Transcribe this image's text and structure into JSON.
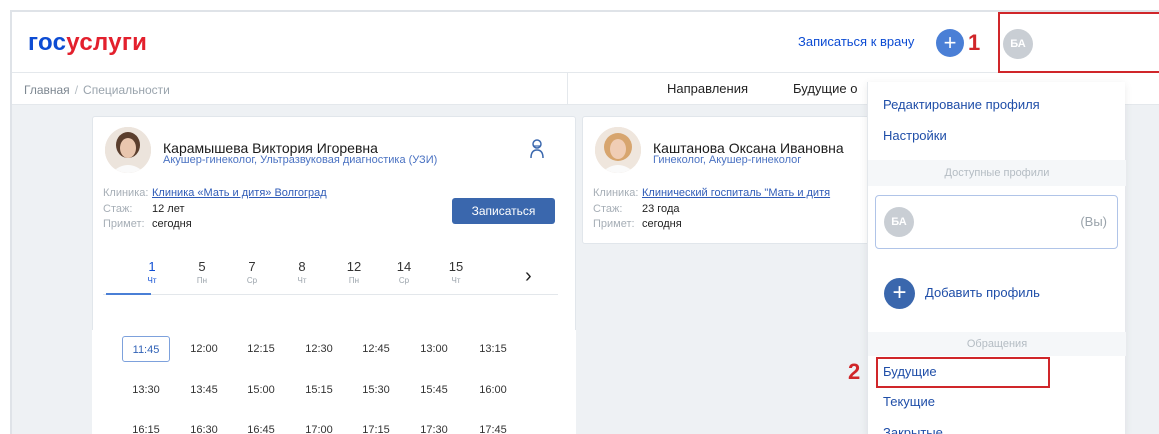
{
  "header": {
    "logo_part1": "гос",
    "logo_part2": "услуги",
    "book_link": "Записаться к врачу",
    "plus_symbol": "+",
    "avatar_initials": "БА",
    "annotation_1": "1"
  },
  "breadcrumb": {
    "home": "Главная",
    "separator": "/",
    "current": "Специальности"
  },
  "tabs": [
    "Направления",
    "Будущие о"
  ],
  "doctors": [
    {
      "name": "Карамышева Виктория Игоревна",
      "specialty": "Акушер-гинеколог, Ультразвуковая диагностика (УЗИ)",
      "clinic_label": "Клиника:",
      "clinic": "Клиника «Мать и дитя» Волгоград",
      "experience_label": "Стаж:",
      "experience": "12 лет",
      "accepts_label": "Примет:",
      "accepts": "сегодня",
      "book_button": "Записаться"
    },
    {
      "name": "Каштанова Оксана Ивановна",
      "specialty": "Гинеколог, Акушер-гинеколог",
      "clinic_label": "Клиника:",
      "clinic": "Клинический госпиталь \"Мать и дитя",
      "experience_label": "Стаж:",
      "experience": "23 года",
      "accepts_label": "Примет:",
      "accepts": "сегодня"
    }
  ],
  "days": [
    {
      "num": "1",
      "wd": "Чт"
    },
    {
      "num": "5",
      "wd": "Пн"
    },
    {
      "num": "7",
      "wd": "Ср"
    },
    {
      "num": "8",
      "wd": "Чт"
    },
    {
      "num": "12",
      "wd": "Пн"
    },
    {
      "num": "14",
      "wd": "Ср"
    },
    {
      "num": "15",
      "wd": "Чт"
    }
  ],
  "next_symbol": "›",
  "slots": [
    [
      "11:45",
      "12:00",
      "12:15",
      "12:30",
      "12:45",
      "13:00",
      "13:15"
    ],
    [
      "13:30",
      "13:45",
      "15:00",
      "15:15",
      "15:30",
      "15:45",
      "16:00"
    ],
    [
      "16:15",
      "16:30",
      "16:45",
      "17:00",
      "17:15",
      "17:30",
      "17:45"
    ]
  ],
  "dropdown": {
    "edit_profile": "Редактирование профиля",
    "settings": "Настройки",
    "available_profiles": "Доступные профили",
    "profile_initials": "БА",
    "profile_you": "(Вы)",
    "add_profile": "Добавить профиль",
    "add_symbol": "+",
    "appeals": "Обращения",
    "future": "Будущие",
    "current": "Текущие",
    "closed": "Закрытые",
    "annotation_2": "2"
  },
  "colors": {
    "brand_blue": "#0d4cd3",
    "brand_red": "#e3202d",
    "annotation_red": "#d0262a",
    "button_blue": "#3a67ad"
  }
}
